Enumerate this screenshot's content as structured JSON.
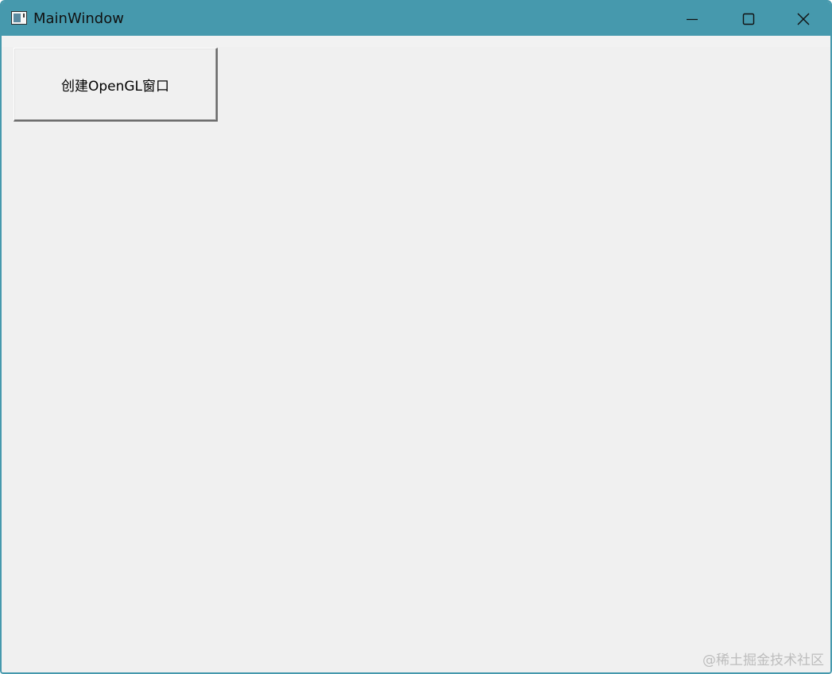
{
  "window": {
    "title": "MainWindow",
    "icon": "window-app-icon",
    "controls": {
      "minimize": "minimize-icon",
      "maximize": "maximize-icon",
      "close": "close-icon"
    },
    "accent_color": "#4699ad"
  },
  "main": {
    "create_button_label": "创建OpenGL窗口"
  },
  "watermark": {
    "text": "@稀土掘金技术社区"
  }
}
